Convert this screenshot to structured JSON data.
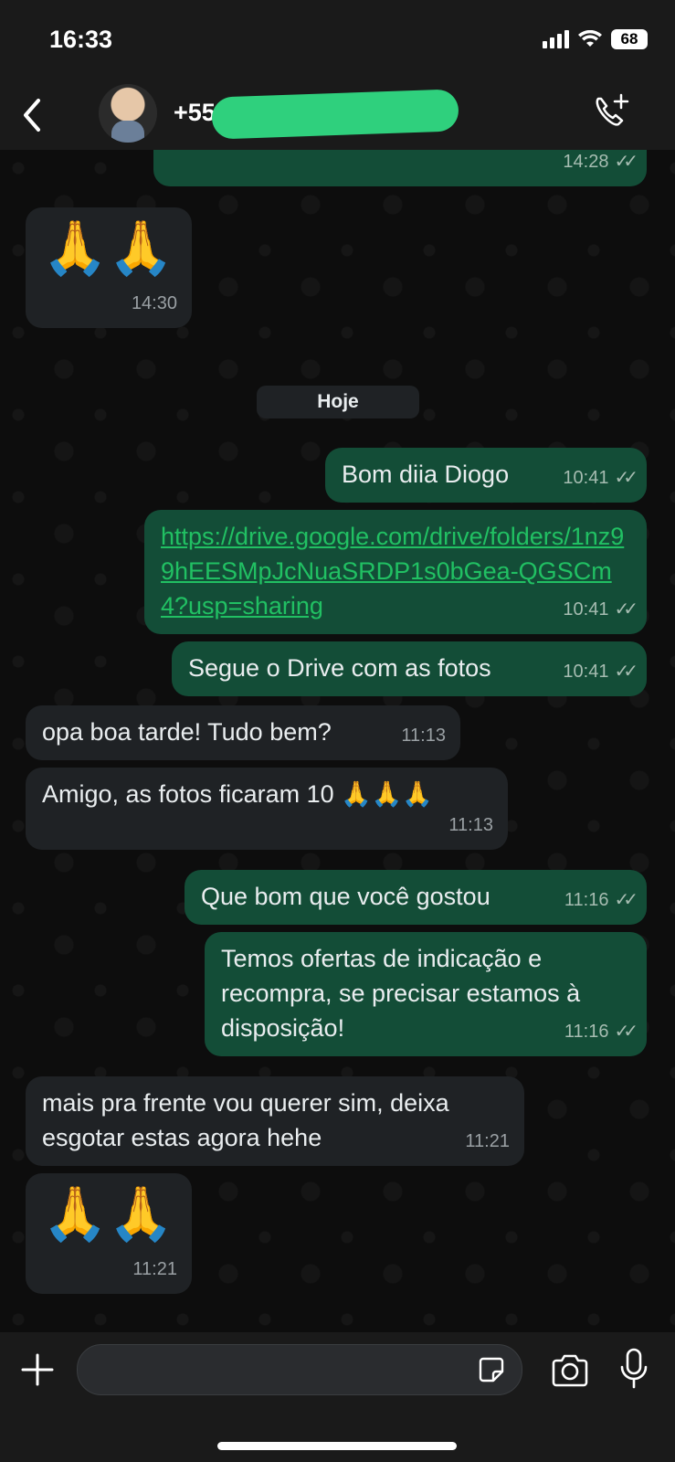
{
  "status_bar": {
    "time": "16:33",
    "battery": "68"
  },
  "header": {
    "contact_name": "+55"
  },
  "chat": {
    "day_chip": "Hoje",
    "messages": [
      {
        "dir": "out",
        "text": "",
        "time": "14:28"
      },
      {
        "dir": "in",
        "text": "🙏🙏",
        "time": "14:30"
      },
      {
        "dir": "out",
        "text": "Bom diia Diogo",
        "time": "10:41"
      },
      {
        "dir": "out",
        "text": "https://drive.google.com/drive/folders/1nz99hEESMpJcNuaSRDP1s0bGea-QGSCm4?usp=sharing",
        "time": "10:41"
      },
      {
        "dir": "out",
        "text": "Segue o Drive com as fotos",
        "time": "10:41"
      },
      {
        "dir": "in",
        "text": "opa boa tarde! Tudo bem?",
        "time": "11:13"
      },
      {
        "dir": "in",
        "text": "Amigo, as fotos ficaram 10 🙏🙏🙏",
        "time": "11:13"
      },
      {
        "dir": "out",
        "text": "Que bom que você gostou",
        "time": "11:16"
      },
      {
        "dir": "out",
        "text": "Temos ofertas de indicação e recompra, se precisar estamos à disposição!",
        "time": "11:16"
      },
      {
        "dir": "in",
        "text": "mais pra frente vou querer sim, deixa esgotar estas agora hehe",
        "time": "11:21"
      },
      {
        "dir": "in",
        "text": "🙏🙏",
        "time": "11:21"
      }
    ]
  },
  "colors": {
    "outgoing_bubble": "#134d37",
    "incoming_bubble": "#1f2225",
    "link": "#21c063",
    "redaction": "#2fd07d"
  },
  "icons": [
    "back-chevron-icon",
    "add-call-icon",
    "plus-icon",
    "sticker-icon",
    "camera-icon",
    "mic-icon"
  ]
}
